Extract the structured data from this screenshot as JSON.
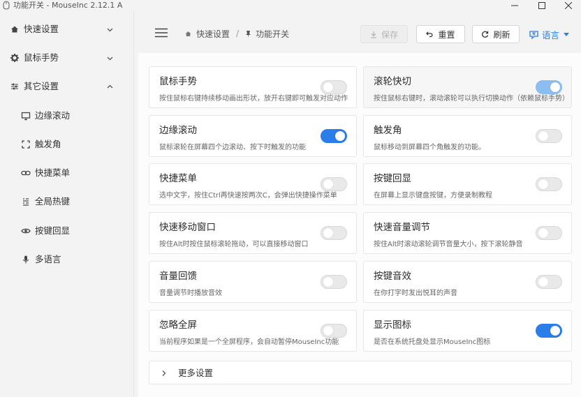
{
  "window": {
    "title": "功能开关 - MouseInc 2.12.1 A"
  },
  "sidebar": {
    "items": [
      {
        "label": "快速设置",
        "icon": "home-icon",
        "expanded": false
      },
      {
        "label": "鼠标手势",
        "icon": "gear-icon",
        "expanded": false
      },
      {
        "label": "其它设置",
        "icon": "sliders-icon",
        "expanded": true
      }
    ],
    "sub_items": [
      {
        "label": "边缘滚动",
        "icon": "monitor-icon"
      },
      {
        "label": "触发角",
        "icon": "corners-icon"
      },
      {
        "label": "快捷菜单",
        "icon": "link-icon"
      },
      {
        "label": "全局热键",
        "icon": "keyboard-icon"
      },
      {
        "label": "按键回显",
        "icon": "eye-icon"
      },
      {
        "label": "多语言",
        "icon": "microphone-icon"
      }
    ]
  },
  "header": {
    "breadcrumb": [
      "快速设置",
      "功能开关"
    ],
    "save_label": "保存",
    "reset_label": "重置",
    "refresh_label": "刷新",
    "language_label": "语言"
  },
  "features": [
    {
      "title": "鼠标手势",
      "desc": "按住鼠标右键持续移动画出形状，放开右键即可触发对应动作",
      "enabled": false
    },
    {
      "title": "滚轮快切",
      "desc": "按住鼠标右键时，滚动滚轮可以执行切换动作（依赖鼠标手势）",
      "enabled": true
    },
    {
      "title": "边缘滚动",
      "desc": "鼠标滚轮在屏幕四个边滚动、按下时触发的功能",
      "enabled": true
    },
    {
      "title": "触发角",
      "desc": "鼠标移动到屏幕四个角触发的功能。",
      "enabled": false
    },
    {
      "title": "快捷菜单",
      "desc": "选中文字，按住Ctrl再快速按两次C，会弹出快捷操作菜单",
      "enabled": false
    },
    {
      "title": "按键回显",
      "desc": "在屏幕上显示键盘按键，方便录制教程",
      "enabled": false
    },
    {
      "title": "快速移动窗口",
      "desc": "按住Alt时按住鼠标滚轮拖动，可以直接移动窗口",
      "enabled": false
    },
    {
      "title": "快速音量调节",
      "desc": "按住Alt时滚动滚轮调节音量大小，按下滚轮静音",
      "enabled": false
    },
    {
      "title": "音量回馈",
      "desc": "音量调节时播放音效",
      "enabled": false
    },
    {
      "title": "按键音效",
      "desc": "在你打字时发出悦耳的声音",
      "enabled": false
    },
    {
      "title": "忽略全屏",
      "desc": "当前程序如果是一个全屏程序，会自动暂停MouseInc功能",
      "enabled": false
    },
    {
      "title": "显示图标",
      "desc": "是否在系统托盘处显示MouseInc图标",
      "enabled": true
    }
  ],
  "more_settings_label": "更多设置",
  "colors": {
    "accent": "#2b7de9",
    "accent_disabled": "#8cbdf2",
    "switch_off": "#e9e9e9"
  }
}
